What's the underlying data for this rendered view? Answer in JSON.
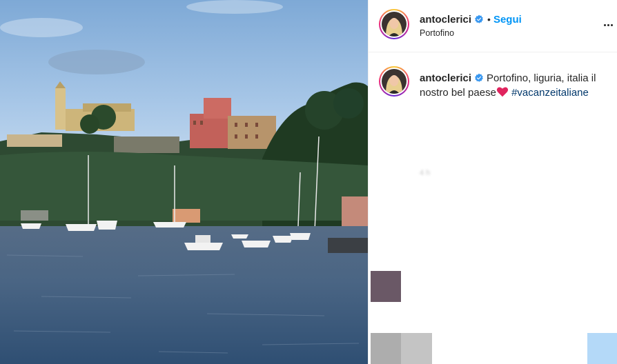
{
  "post": {
    "username": "antoclerici",
    "verified": true,
    "separator": "•",
    "follow_label": "Segui",
    "location": "Portofino",
    "more_icon": "more-horizontal-icon"
  },
  "caption": {
    "username": "antoclerici",
    "text": "Portofino, liguria, italia il nostro bel paese",
    "emoji": "heart-emoji",
    "hashtag": "#vacanzeitaliane",
    "timestamp": "4 h"
  },
  "colors": {
    "link_blue": "#0095f6",
    "hashtag": "#00376b",
    "verified_badge": "#3897f0",
    "heart": "#e0245e"
  },
  "photo": {
    "subject": "Portofino harbor with boats, hillside church and villa"
  }
}
